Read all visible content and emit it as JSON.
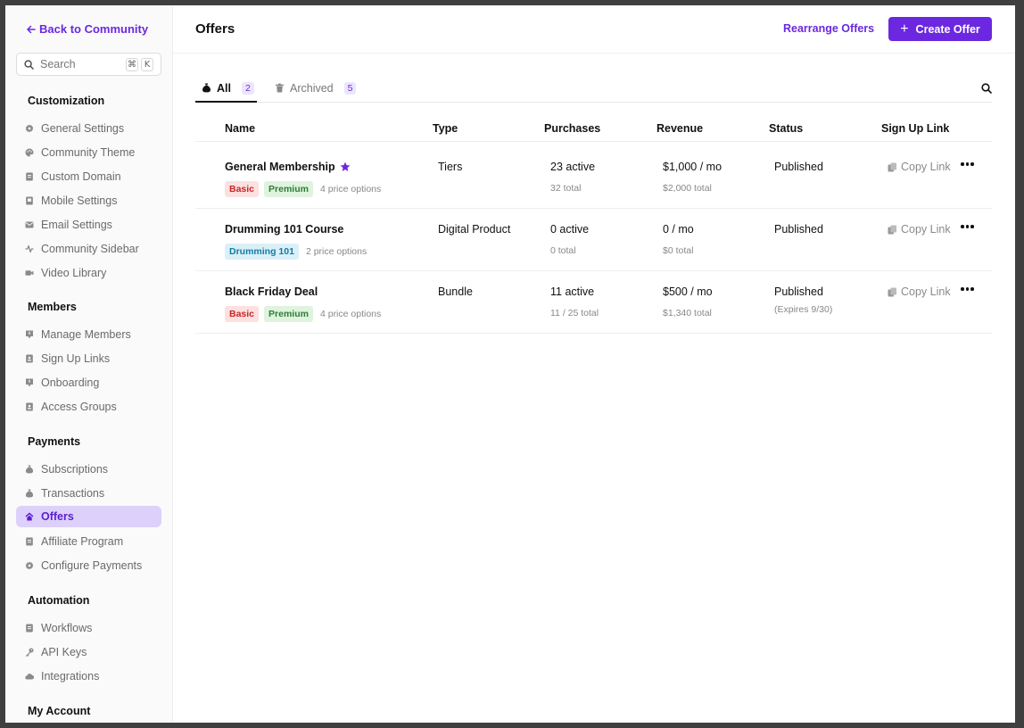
{
  "sidebar": {
    "back_label": "Back to Community",
    "search": {
      "placeholder": "Search",
      "shortcut_cmd": "⌘",
      "shortcut_key": "K"
    },
    "sections": {
      "customization": "Customization",
      "members": "Members",
      "payments": "Payments",
      "automation": "Automation",
      "my_account": "My Account"
    },
    "items": {
      "general_settings": "General Settings",
      "community_theme": "Community Theme",
      "custom_domain": "Custom Domain",
      "mobile_settings": "Mobile Settings",
      "email_settings": "Email Settings",
      "community_sidebar": "Community Sidebar",
      "video_library": "Video Library",
      "manage_members": "Manage Members",
      "sign_up_links": "Sign Up Links",
      "onboarding": "Onboarding",
      "access_groups": "Access Groups",
      "subscriptions": "Subscriptions",
      "transactions": "Transactions",
      "offers": "Offers",
      "affiliate_program": "Affiliate Program",
      "configure_payments": "Configure Payments",
      "workflows": "Workflows",
      "api_keys": "API Keys",
      "integrations": "Integrations"
    },
    "active_item": "offers",
    "accent_color": "#6b28e0"
  },
  "header": {
    "title": "Offers",
    "rearrange_label": "Rearrange Offers",
    "create_label": "Create Offer"
  },
  "tabs": {
    "all": {
      "label": "All",
      "count": "2"
    },
    "archived": {
      "label": "Archived",
      "count": "5"
    }
  },
  "table": {
    "columns": {
      "name": "Name",
      "type": "Type",
      "purchases": "Purchases",
      "revenue": "Revenue",
      "status": "Status",
      "signup": "Sign Up Link"
    },
    "copy_label": "Copy Link",
    "rows": [
      {
        "name": "General Membership",
        "badge1": "Basic",
        "badge2": "Premium",
        "price_options": "4 price options",
        "type": "Tiers",
        "purchases": "23 active",
        "purchases_total": "32 total",
        "revenue": "$1,000 / mo",
        "revenue_total": "$2,000 total",
        "status": "Published"
      },
      {
        "name": "Drumming 101 Course",
        "badge1": "Drumming 101",
        "price_options": "2 price options",
        "type": "Digital Product",
        "purchases": "0 active",
        "purchases_total": "0 total",
        "revenue": "0 / mo",
        "revenue_total": "$0 total",
        "status": "Published"
      },
      {
        "name": "Black Friday Deal",
        "badge1": "Basic",
        "badge2": "Premium",
        "price_options": "4 price options",
        "type": "Bundle",
        "purchases": "11 active",
        "purchases_total": "11 / 25 total",
        "revenue": "$500 / mo",
        "revenue_total": "$1,340 total",
        "status": "Published",
        "status_note": "(Expires 9/30)"
      }
    ]
  }
}
